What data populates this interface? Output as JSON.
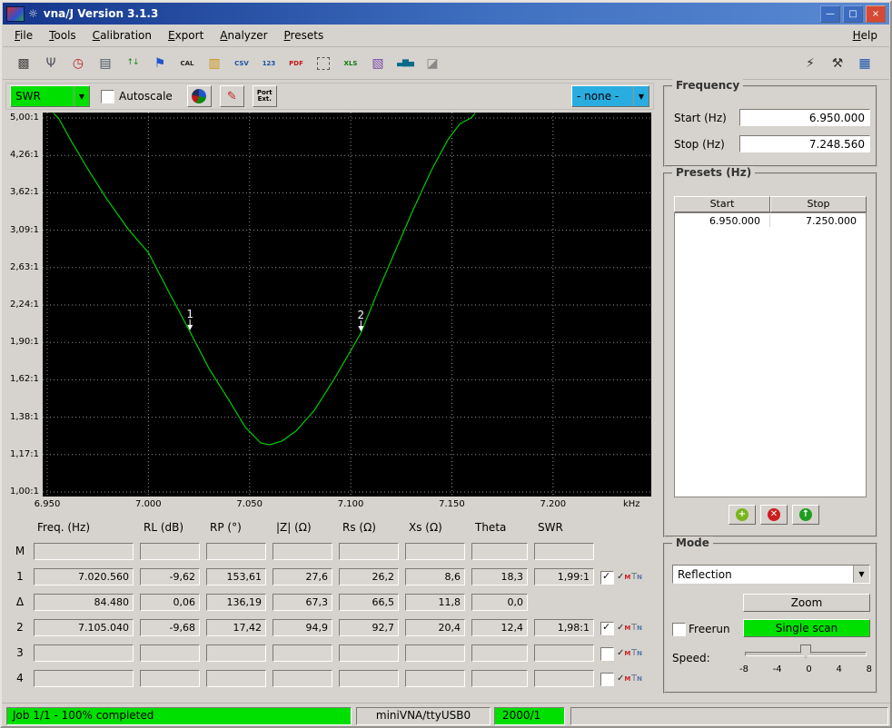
{
  "window": {
    "title": "vna/J Version 3.1.3",
    "controls": {
      "minimize": "—",
      "maximize": "□",
      "close": "×"
    }
  },
  "menu": {
    "items": [
      "File",
      "Tools",
      "Calibration",
      "Export",
      "Analyzer",
      "Presets"
    ],
    "help": "Help"
  },
  "toolbar": {
    "left_icons": [
      {
        "name": "generator-icon",
        "glyph": "▩",
        "color": "#444444"
      },
      {
        "name": "antenna-icon",
        "glyph": "Ψ",
        "color": "#555566"
      },
      {
        "name": "schedule-icon",
        "glyph": "◷",
        "color": "#bb2222"
      },
      {
        "name": "print-icon",
        "glyph": "▤",
        "color": "#445566"
      },
      {
        "name": "multitune-icon",
        "glyph": "↑↓",
        "color": "#118811",
        "small": true
      },
      {
        "name": "tag-icon",
        "glyph": "⚑",
        "color": "#2255cc"
      },
      {
        "name": "calibration-icon",
        "text": "CAL",
        "color": "#222222"
      },
      {
        "name": "open-folder-icon",
        "glyph": "▥",
        "color": "#c8960c"
      },
      {
        "name": "export-csv-icon",
        "text": "CSV",
        "color": "#1a52a8"
      },
      {
        "name": "export-table-icon",
        "text": "123",
        "color": "#1a52a8"
      },
      {
        "name": "export-pdf-icon",
        "text": "PDF",
        "color": "#c01818"
      },
      {
        "name": "snapshot-icon",
        "dashed": true
      },
      {
        "name": "export-xls-icon",
        "text": "XLS",
        "color": "#0a7a0a"
      },
      {
        "name": "export-image-icon",
        "glyph": "▧",
        "color": "#7a4aa8"
      },
      {
        "name": "export-chart-icon",
        "glyph": "▃▆▄",
        "color": "#0a6a8a",
        "small": true
      },
      {
        "name": "clear-icon",
        "glyph": "◪",
        "color": "#888888"
      }
    ],
    "right_icons": [
      {
        "name": "driver-icon",
        "glyph": "⚡",
        "color": "#333333"
      },
      {
        "name": "settings-icon",
        "glyph": "⚒",
        "color": "#333333"
      },
      {
        "name": "frequency-grid-icon",
        "glyph": "▦",
        "color": "#1a52a8"
      }
    ]
  },
  "chart_controls": {
    "left_scale": "SWR",
    "autoscale_label": "Autoscale",
    "right_scale": "- none -",
    "portext_line1": "Port",
    "portext_line2": "Ext."
  },
  "colors": {
    "accent_green": "#00e000",
    "scale_right": "#29acdf",
    "curve": "#00cc00",
    "progress": "#00e000",
    "scan_button": "#00e000"
  },
  "chart_data": {
    "type": "line",
    "title": "SWR vs frequency sweep",
    "xlabel": "kHz",
    "ylabel": "SWR",
    "x_unit": "kHz",
    "x_range": [
      6.95,
      7.24856
    ],
    "y_range": [
      1.0,
      5.0
    ],
    "y_scale": "log",
    "grid": true,
    "x_ticks": [
      6.95,
      7.0,
      7.05,
      7.1,
      7.15,
      7.2
    ],
    "x_tick_labels": [
      "6.950",
      "7.000",
      "7.050",
      "7.100",
      "7.150",
      "7.200"
    ],
    "y_tick_labels": [
      "5,00:1",
      "4,26:1",
      "3,62:1",
      "3,09:1",
      "2,63:1",
      "2,24:1",
      "1,90:1",
      "1,62:1",
      "1,38:1",
      "1,17:1",
      "1,00:1"
    ],
    "series": [
      {
        "name": "SWR",
        "x": [
          6.953,
          6.9555,
          6.962,
          6.97,
          6.979,
          6.99,
          7.0,
          7.01,
          7.0206,
          7.03,
          7.04,
          7.048,
          7.0555,
          7.06,
          7.066,
          7.073,
          7.082,
          7.092,
          7.105,
          7.113,
          7.122,
          7.131,
          7.14,
          7.148,
          7.154,
          7.1595,
          7.1615
        ],
        "values": [
          5.4,
          5.0,
          4.52,
          4.02,
          3.55,
          3.1,
          2.8,
          2.37,
          1.99,
          1.7,
          1.48,
          1.32,
          1.235,
          1.225,
          1.245,
          1.3,
          1.42,
          1.63,
          1.98,
          2.35,
          2.82,
          3.38,
          4.0,
          4.55,
          4.88,
          5.0,
          5.4
        ]
      }
    ],
    "markers": [
      {
        "label": "1",
        "x": 7.02056,
        "y": 1.99
      },
      {
        "label": "2",
        "x": 7.10504,
        "y": 1.98
      }
    ]
  },
  "marker_table": {
    "headers": [
      "Freq. (Hz)",
      "RL (dB)",
      "RP (°)",
      "|Z| (Ω)",
      "Rs (Ω)",
      "Xs (Ω)",
      "Theta",
      "SWR"
    ],
    "row_icons": [
      {
        "name": "marker-max-icon",
        "main": "✓",
        "main_color": "#222222",
        "sub": "M",
        "sub_color": "#cc2222"
      },
      {
        "name": "marker-track-icon",
        "main": "T",
        "main_color": "#667788",
        "sub": "N",
        "sub_color": "#5577aa"
      }
    ],
    "rows": [
      {
        "label": "M",
        "values": [
          "",
          "",
          "",
          "",
          "",
          "",
          "",
          ""
        ],
        "checkbox": null,
        "icons": false
      },
      {
        "label": "1",
        "values": [
          "7.020.560",
          "-9,62",
          "153,61",
          "27,6",
          "26,2",
          "8,6",
          "18,3",
          "1,99:1"
        ],
        "checkbox": "checked",
        "icons": true
      },
      {
        "label": "Δ",
        "values": [
          "84.480",
          "0,06",
          "136,19",
          "67,3",
          "66,5",
          "11,8",
          "0,0",
          null
        ],
        "checkbox": null,
        "icons": false
      },
      {
        "label": "2",
        "values": [
          "7.105.040",
          "-9,68",
          "17,42",
          "94,9",
          "92,7",
          "20,4",
          "12,4",
          "1,98:1"
        ],
        "checkbox": "checked",
        "icons": true
      },
      {
        "label": "3",
        "values": [
          "",
          "",
          "",
          "",
          "",
          "",
          "",
          ""
        ],
        "checkbox": "unchecked",
        "icons": true
      },
      {
        "label": "4",
        "values": [
          "",
          "",
          "",
          "",
          "",
          "",
          "",
          ""
        ],
        "checkbox": "unchecked",
        "icons": true
      }
    ]
  },
  "frequency_panel": {
    "title": "Frequency",
    "start_label": "Start (Hz)",
    "start_value": "6.950.000",
    "stop_label": "Stop (Hz)",
    "stop_value": "7.248.560"
  },
  "presets_panel": {
    "title": "Presets (Hz)",
    "headers": [
      "Start",
      "Stop"
    ],
    "rows": [
      [
        "6.950.000",
        "7.250.000"
      ]
    ]
  },
  "mode_panel": {
    "title": "Mode",
    "mode_value": "Reflection",
    "zoom_label": "Zoom",
    "freerun_label": "Freerun",
    "scan_label": "Single scan",
    "speed_label": "Speed:",
    "speed_ticks": [
      "-8",
      "-4",
      "0",
      "4",
      "8"
    ]
  },
  "status_bar": {
    "progress_text": "Job 1/1 - 100% completed",
    "device": "miniVNA/ttyUSB0",
    "samples": "2000/1",
    "extra": ""
  }
}
